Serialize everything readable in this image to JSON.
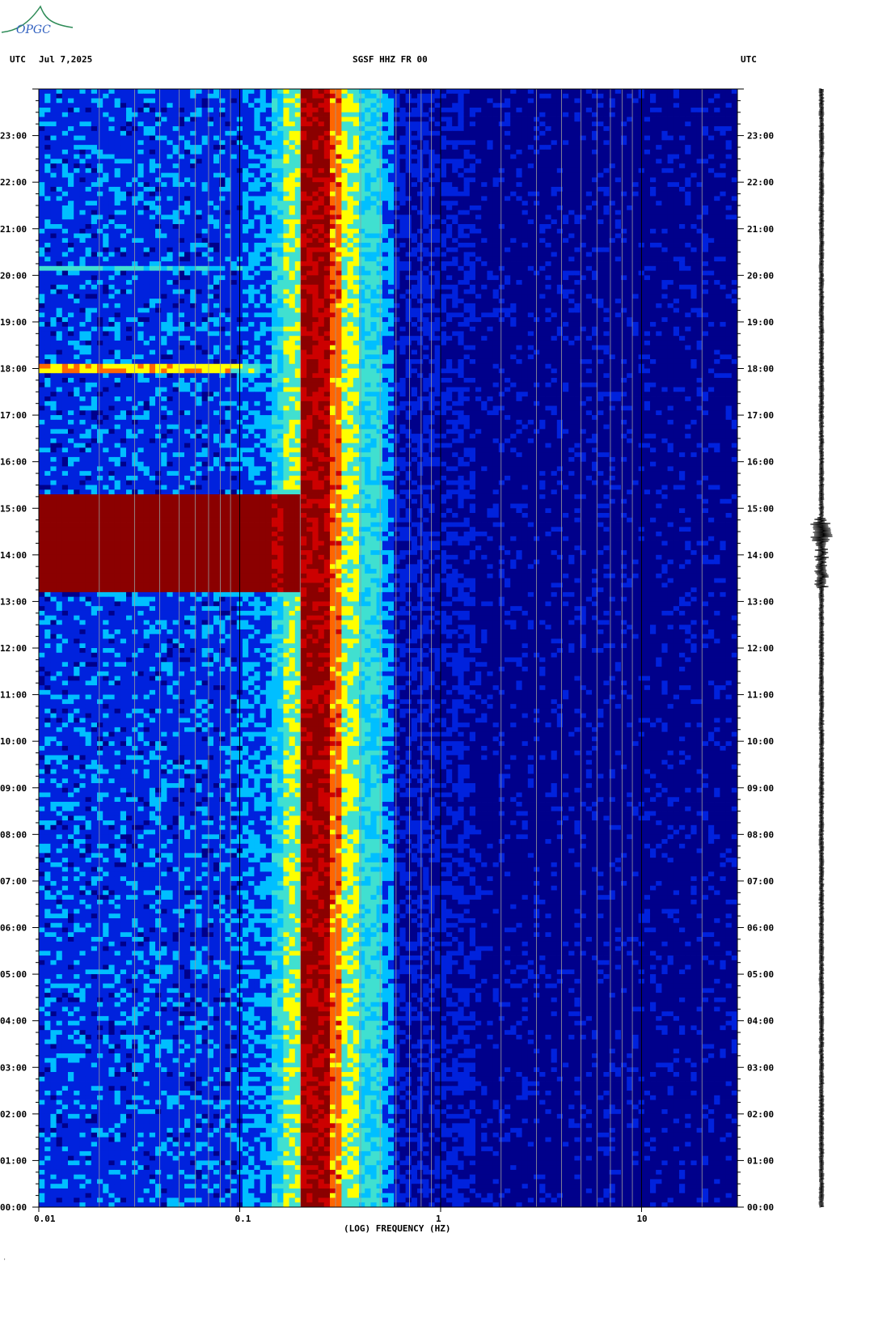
{
  "header": {
    "utc_left": "UTC",
    "date": "Jul 7,2025",
    "station": "SGSF HHZ FR 00",
    "utc_right": "UTC"
  },
  "logo": {
    "text": "OPGC",
    "accent": "#2e8b57",
    "text_color": "#3060c0"
  },
  "chart_data": {
    "type": "heatmap",
    "title": "SGSF HHZ FR 00",
    "xlabel": "(LOG) FREQUENCY (HZ)",
    "ylabel": "",
    "x_scale": "log",
    "xlim": [
      0.01,
      30
    ],
    "x_ticks": [
      0.01,
      0.1,
      1,
      10
    ],
    "x_tick_labels": [
      "0.01",
      "0.1",
      "1",
      "10"
    ],
    "ylim_hours": [
      0,
      24
    ],
    "y_ticks": [
      0,
      1,
      2,
      3,
      4,
      5,
      6,
      7,
      8,
      9,
      10,
      11,
      12,
      13,
      14,
      15,
      16,
      17,
      18,
      19,
      20,
      21,
      22,
      23
    ],
    "y_tick_labels": [
      "00:00",
      "01:00",
      "02:00",
      "03:00",
      "04:00",
      "05:00",
      "06:00",
      "07:00",
      "08:00",
      "09:00",
      "10:00",
      "11:00",
      "12:00",
      "13:00",
      "14:00",
      "15:00",
      "16:00",
      "17:00",
      "18:00",
      "19:00",
      "20:00",
      "21:00",
      "22:00",
      "23:00"
    ],
    "colormap": [
      "#00008b",
      "#0022dd",
      "#00bfff",
      "#40e0d0",
      "#ffff00",
      "#ff6600",
      "#cc0000",
      "#8b0000"
    ],
    "microseism_peak_hz": [
      0.2,
      0.28
    ],
    "events": [
      {
        "start_hour": 13.2,
        "end_hour": 15.3,
        "max_hz": 0.2,
        "intensity": "high"
      },
      {
        "start_hour": 17.95,
        "end_hour": 18.05,
        "max_hz": 0.13,
        "intensity": "medium"
      },
      {
        "start_hour": 20.15,
        "end_hour": 20.22,
        "max_hz": 0.1,
        "intensity": "low"
      }
    ],
    "seismogram_burst_hours": [
      13.3,
      14.8
    ]
  }
}
